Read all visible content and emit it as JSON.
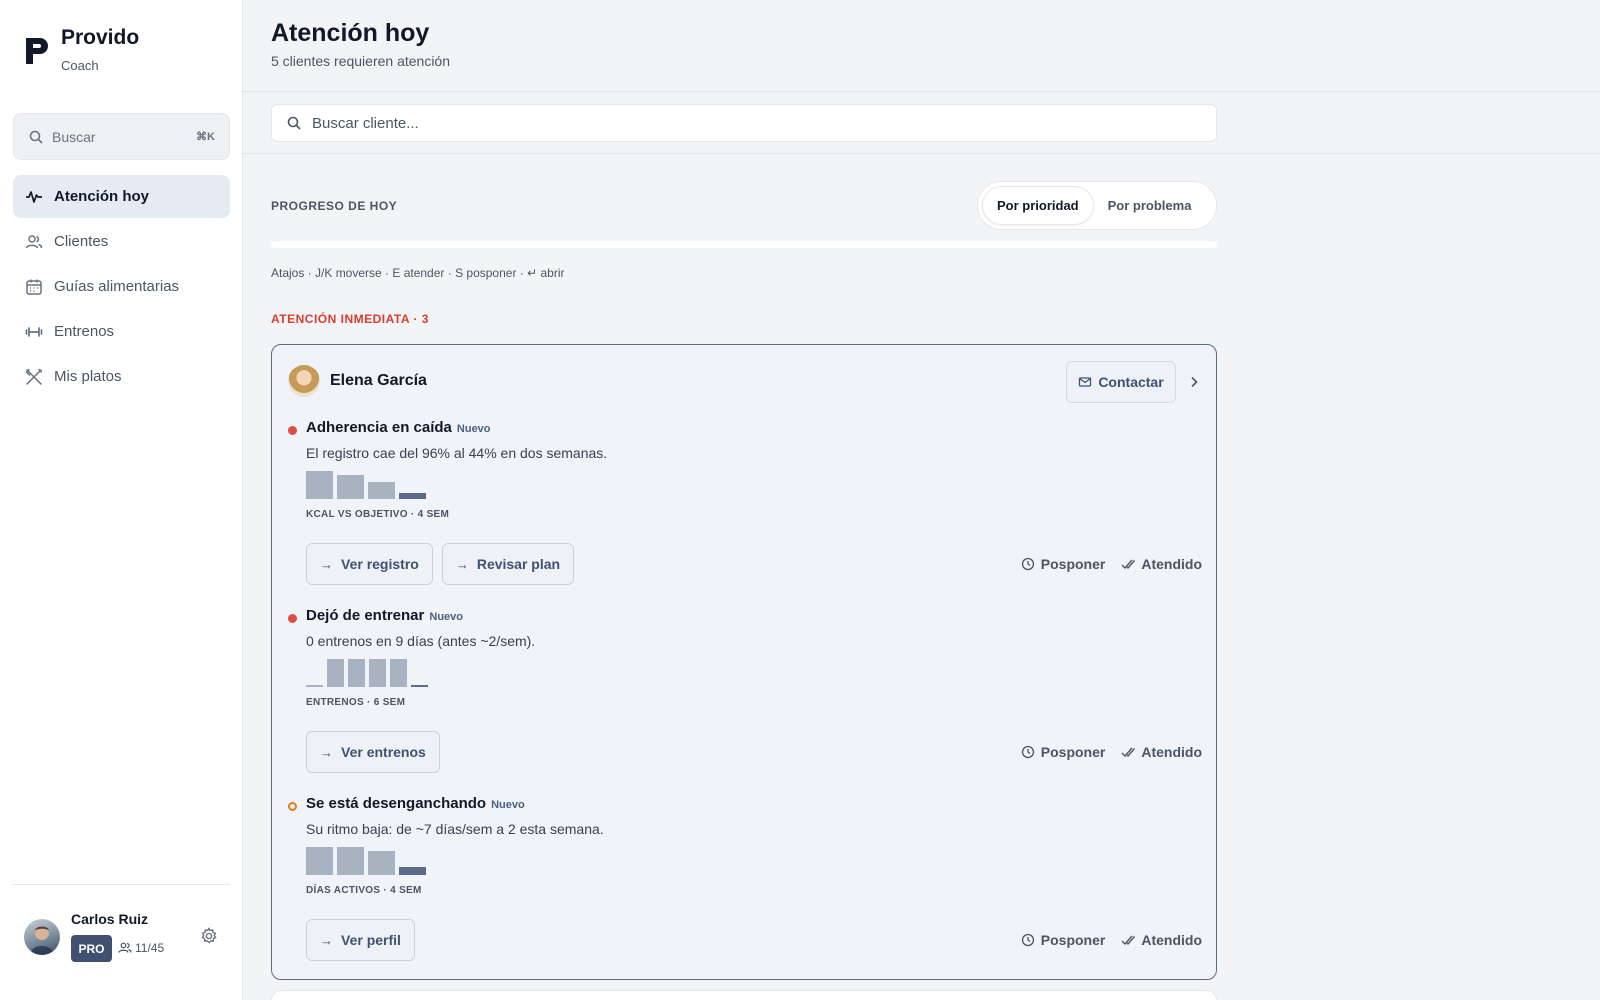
{
  "brand": {
    "name": "Provido",
    "subtitle": "Coach"
  },
  "sidebar": {
    "search": {
      "label": "Buscar",
      "shortcut": "⌘K"
    },
    "items": [
      {
        "label": "Atención hoy",
        "icon": "activity-icon",
        "active": true
      },
      {
        "label": "Clientes",
        "icon": "users-icon",
        "active": false
      },
      {
        "label": "Guías alimentarias",
        "icon": "calendar-icon",
        "active": false
      },
      {
        "label": "Entrenos",
        "icon": "dumbbell-icon",
        "active": false
      },
      {
        "label": "Mis platos",
        "icon": "utensils-icon",
        "active": false
      }
    ],
    "user": {
      "name": "Carlos Ruiz",
      "plan": "PRO",
      "clients": "11/45"
    }
  },
  "header": {
    "title": "Atención hoy",
    "subtitle": "5 clientes requieren atención"
  },
  "search": {
    "placeholder": "Buscar cliente..."
  },
  "progress": {
    "label": "PROGRESO DE HOY",
    "value_fraction": 0.0,
    "toggle": [
      {
        "label": "Por prioridad",
        "active": true
      },
      {
        "label": "Por problema",
        "active": false
      }
    ]
  },
  "shortcuts": "Atajos · J/K moverse · E atender · S posponer · ↵ abrir",
  "section": {
    "title": "ATENCIÓN INMEDIATA · 3"
  },
  "card": {
    "client_name": "Elena García",
    "contact_label": "Contactar",
    "issues": [
      {
        "title": "Adherencia en caída",
        "tag": "Nuevo",
        "severity": "red",
        "description": "El registro cae del 96% al 44% en dos semanas.",
        "bars": [
          1.0,
          0.85,
          0.62,
          0.22
        ],
        "bars_label": "KCAL VS OBJETIVO · 4 SEM",
        "actions": [
          "Ver registro",
          "Revisar plan"
        ],
        "postpone": "Posponer",
        "done": "Atendido"
      },
      {
        "title": "Dejó de entrenar",
        "tag": "Nuevo",
        "severity": "red",
        "description": "0 entrenos en 9 días (antes ~2/sem).",
        "bars": [
          0.03,
          1.0,
          1.0,
          1.0,
          1.0,
          0.03
        ],
        "bars_label": "ENTRENOS · 6 SEM",
        "actions": [
          "Ver entrenos"
        ],
        "postpone": "Posponer",
        "done": "Atendido"
      },
      {
        "title": "Se está desenganchando",
        "tag": "Nuevo",
        "severity": "orange",
        "description": "Su ritmo baja: de ~7 días/sem a 2 esta semana.",
        "bars": [
          1.0,
          1.0,
          0.85,
          0.3
        ],
        "bars_label": "DÍAS ACTIVOS · 4 SEM",
        "actions": [
          "Ver perfil"
        ],
        "postpone": "Posponer",
        "done": "Atendido"
      }
    ]
  }
}
